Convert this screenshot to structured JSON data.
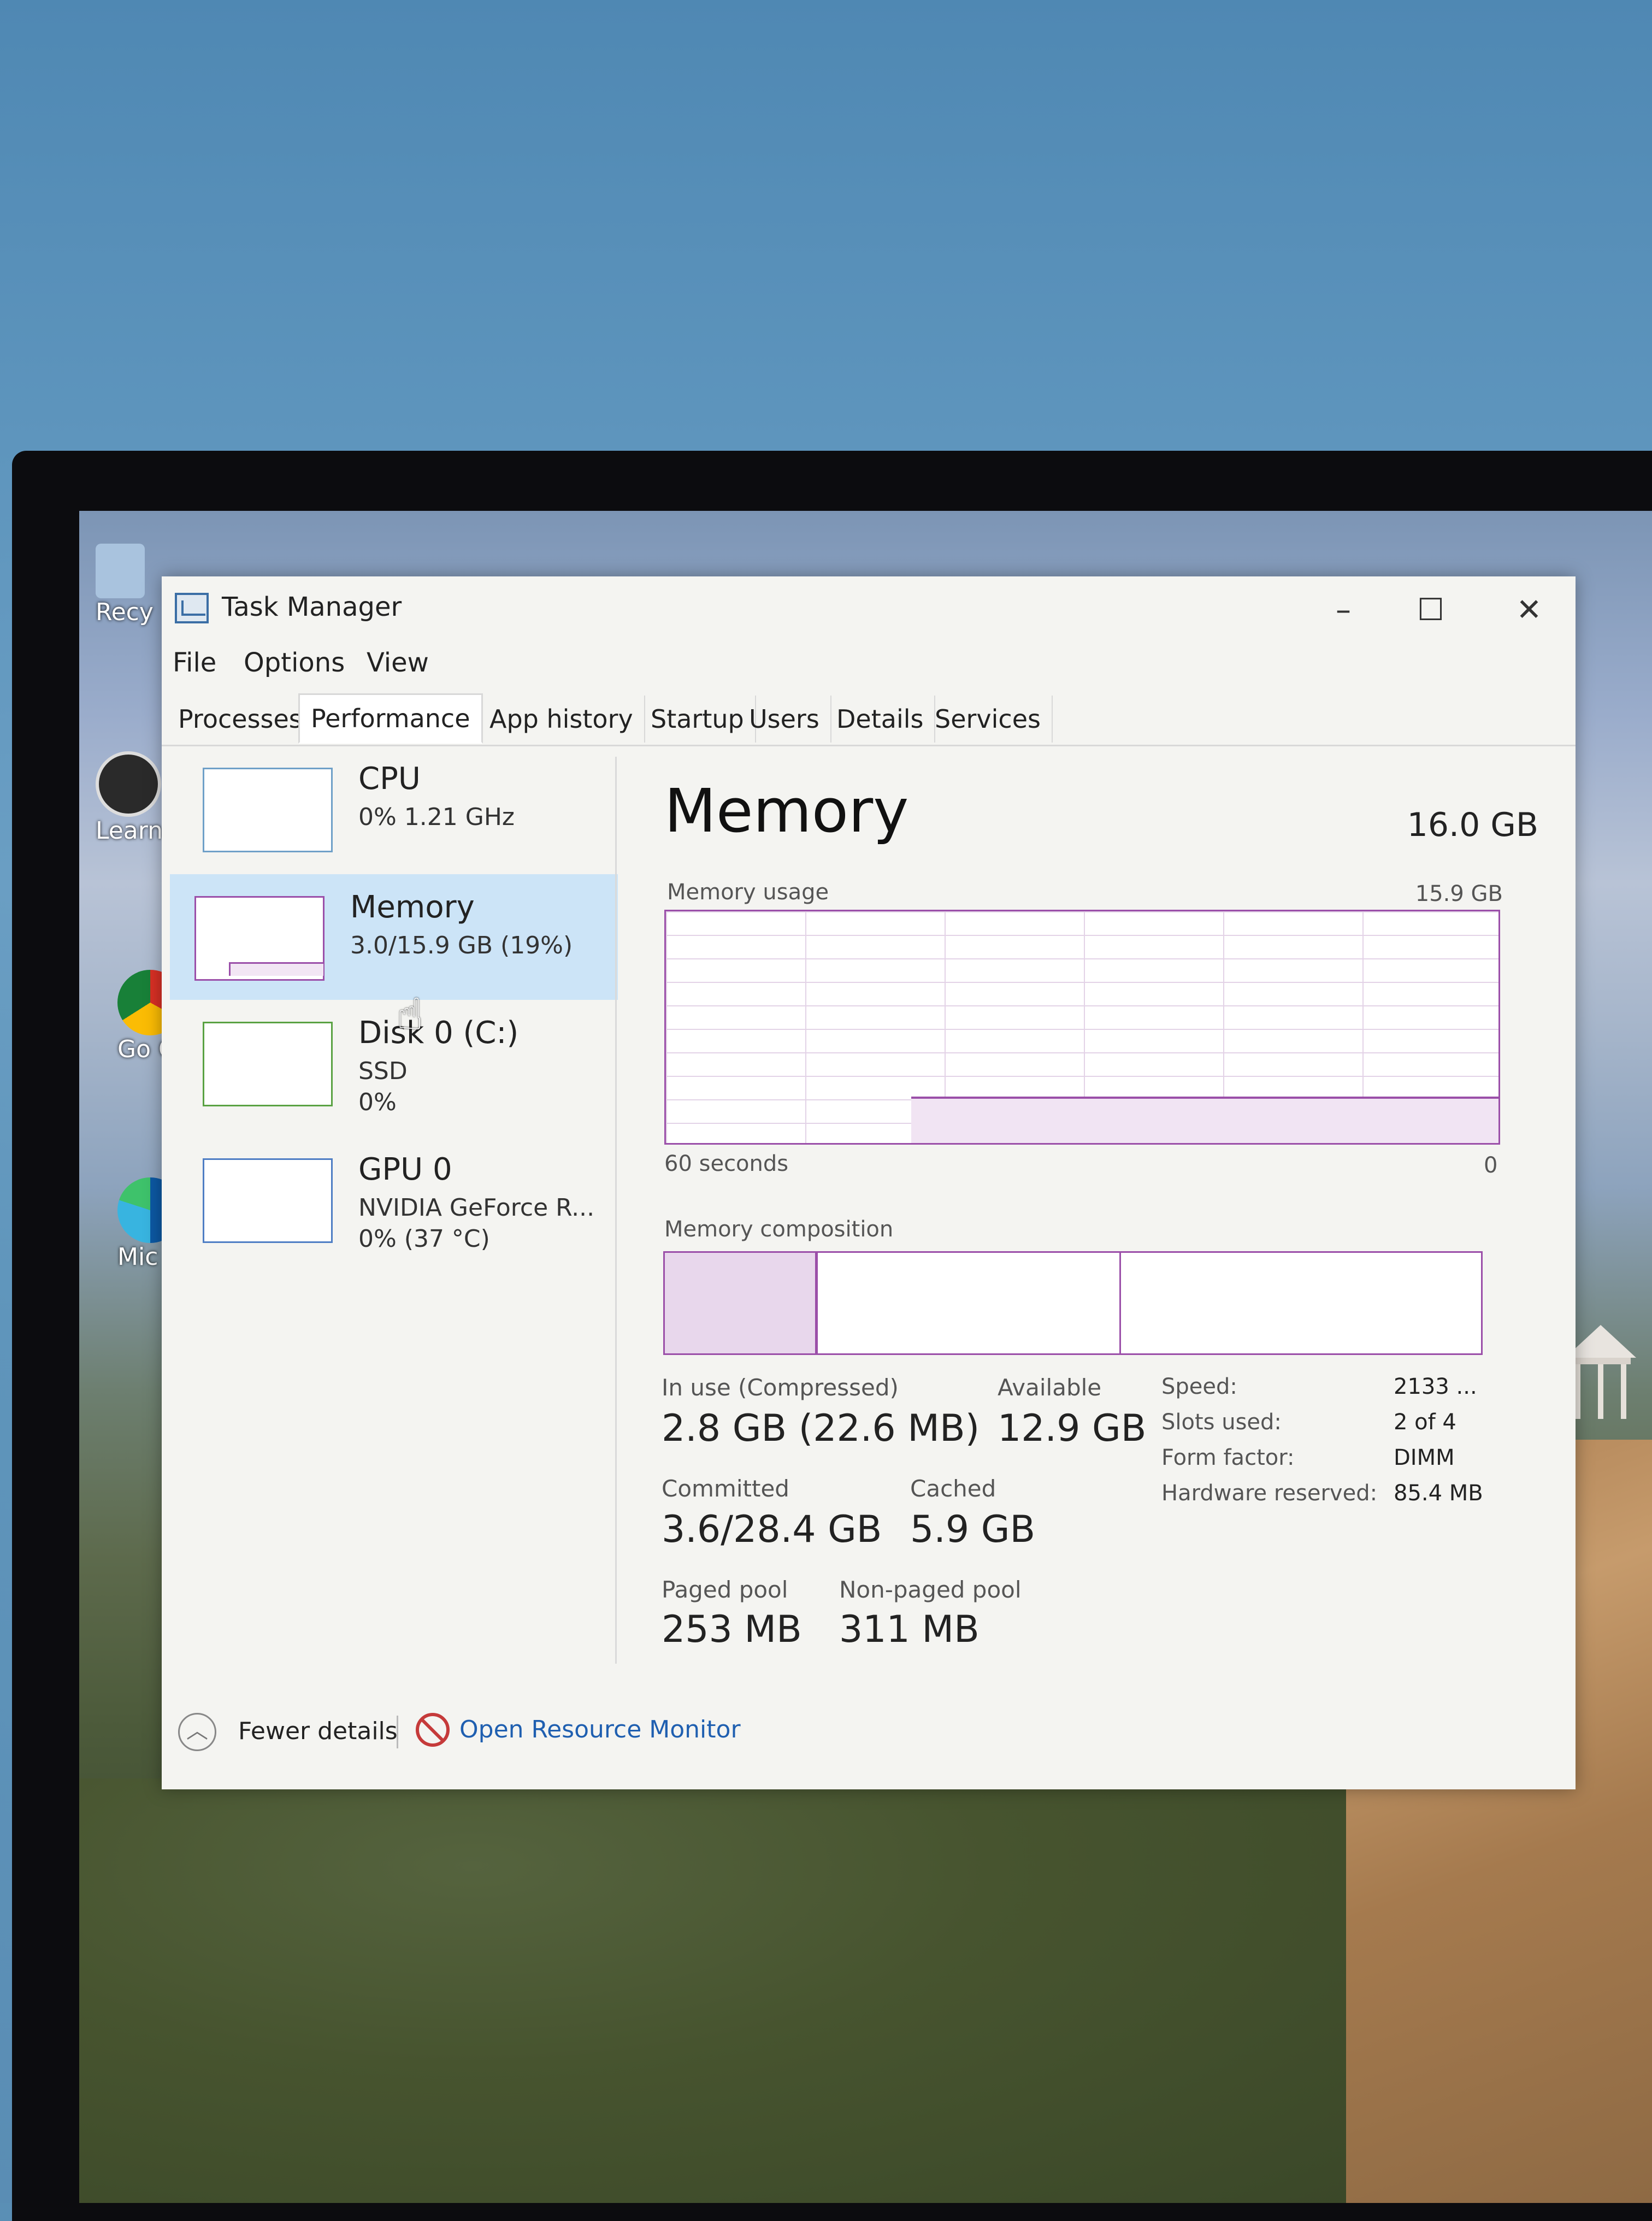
{
  "window": {
    "title": "Task Manager",
    "controls": {
      "minimize": "–",
      "maximize": "☐",
      "close": "✕"
    }
  },
  "menu": [
    "File",
    "Options",
    "View"
  ],
  "tabs": [
    "Processes",
    "Performance",
    "App history",
    "Startup",
    "Users",
    "Details",
    "Services"
  ],
  "active_tab": "Performance",
  "sidebar": {
    "cpu": {
      "name": "CPU",
      "line1": "0% 1.21 GHz"
    },
    "memory": {
      "name": "Memory",
      "line1": "3.0/15.9 GB (19%)"
    },
    "disk": {
      "name": "Disk 0 (C:)",
      "line1": "SSD",
      "line2": "0%"
    },
    "gpu": {
      "name": "GPU 0",
      "line1": "NVIDIA GeForce R...",
      "line2": "0% (37 °C)"
    }
  },
  "main": {
    "title": "Memory",
    "total": "16.0 GB",
    "usage_label": "Memory usage",
    "usage_max": "15.9 GB",
    "time_left": "60 seconds",
    "time_right": "0",
    "composition_label": "Memory composition",
    "usage_fraction": 0.19,
    "stats": {
      "in_use_label": "In use (Compressed)",
      "in_use_value": "2.8 GB (22.6 MB)",
      "available_label": "Available",
      "available_value": "12.9 GB",
      "committed_label": "Committed",
      "committed_value": "3.6/28.4 GB",
      "cached_label": "Cached",
      "cached_value": "5.9 GB",
      "paged_label": "Paged pool",
      "paged_value": "253 MB",
      "nonpaged_label": "Non-paged pool",
      "nonpaged_value": "311 MB"
    },
    "details": {
      "speed_key": "Speed:",
      "speed_val": "2133 ...",
      "slots_key": "Slots used:",
      "slots_val": "2 of 4",
      "form_key": "Form factor:",
      "form_val": "DIMM",
      "hw_key": "Hardware reserved:",
      "hw_val": "85.4 MB"
    }
  },
  "footer": {
    "fewer": "Fewer details",
    "resource_monitor": "Open Resource Monitor"
  },
  "desktop": {
    "icons": [
      "Recy",
      "Learn this",
      "Go Chr",
      "Mic Ed"
    ]
  },
  "colors": {
    "memory_accent": "#9b4fa9",
    "selected_bg": "#cce4f7",
    "link": "#1f5fb0"
  }
}
